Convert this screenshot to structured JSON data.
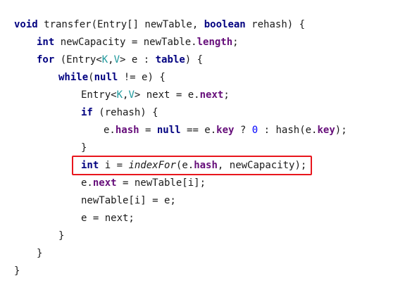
{
  "code": {
    "lines": [
      [
        {
          "cls": "kw",
          "text": "void"
        },
        {
          "cls": "",
          "text": " transfer(Entry[] newTable, "
        },
        {
          "cls": "kw",
          "text": "boolean"
        },
        {
          "cls": "",
          "text": " rehash) {"
        }
      ],
      [
        {
          "cls": "kw",
          "text": "int"
        },
        {
          "cls": "",
          "text": " newCapacity = newTable."
        },
        {
          "cls": "fld",
          "text": "length"
        },
        {
          "cls": "",
          "text": ";"
        }
      ],
      [
        {
          "cls": "kw",
          "text": "for"
        },
        {
          "cls": "",
          "text": " (Entry<"
        },
        {
          "cls": "tp",
          "text": "K"
        },
        {
          "cls": "",
          "text": ","
        },
        {
          "cls": "tp",
          "text": "V"
        },
        {
          "cls": "",
          "text": "> e : "
        },
        {
          "cls": "kw",
          "text": "table"
        },
        {
          "cls": "",
          "text": ") {"
        }
      ],
      [
        {
          "cls": "kw",
          "text": "while"
        },
        {
          "cls": "",
          "text": "("
        },
        {
          "cls": "kw",
          "text": "null"
        },
        {
          "cls": "",
          "text": " != e) {"
        }
      ],
      [
        {
          "cls": "",
          "text": "Entry<"
        },
        {
          "cls": "tp",
          "text": "K"
        },
        {
          "cls": "",
          "text": ","
        },
        {
          "cls": "tp",
          "text": "V"
        },
        {
          "cls": "",
          "text": "> next = e."
        },
        {
          "cls": "fld",
          "text": "next"
        },
        {
          "cls": "",
          "text": ";"
        }
      ],
      [
        {
          "cls": "kw",
          "text": "if"
        },
        {
          "cls": "",
          "text": " (rehash) {"
        }
      ],
      [
        {
          "cls": "",
          "text": "e."
        },
        {
          "cls": "fld",
          "text": "hash"
        },
        {
          "cls": "",
          "text": " = "
        },
        {
          "cls": "kw",
          "text": "null"
        },
        {
          "cls": "",
          "text": " == e."
        },
        {
          "cls": "fld",
          "text": "key"
        },
        {
          "cls": "",
          "text": " ? "
        },
        {
          "cls": "num",
          "text": "0"
        },
        {
          "cls": "",
          "text": " : hash(e."
        },
        {
          "cls": "fld",
          "text": "key"
        },
        {
          "cls": "",
          "text": ");"
        }
      ],
      [
        {
          "cls": "",
          "text": "}"
        }
      ],
      [
        {
          "cls": "kw",
          "text": "int"
        },
        {
          "cls": "",
          "text": " i = "
        },
        {
          "cls": "it",
          "text": "indexFor"
        },
        {
          "cls": "",
          "text": "(e."
        },
        {
          "cls": "fld",
          "text": "hash"
        },
        {
          "cls": "",
          "text": ", newCapacity);"
        }
      ],
      [
        {
          "cls": "",
          "text": "e."
        },
        {
          "cls": "fld",
          "text": "next"
        },
        {
          "cls": "",
          "text": " = newTable[i];"
        }
      ],
      [
        {
          "cls": "",
          "text": "newTable[i] = e;"
        }
      ],
      [
        {
          "cls": "",
          "text": "e = next;"
        }
      ],
      [
        {
          "cls": "",
          "text": "}"
        }
      ],
      [
        {
          "cls": "",
          "text": "}"
        }
      ],
      [
        {
          "cls": "",
          "text": "}"
        }
      ]
    ]
  },
  "colors": {
    "keyword": "#000080",
    "field": "#660e7a",
    "type_param": "#20999d",
    "number": "#0000ff",
    "highlight_border": "#e8161d"
  }
}
